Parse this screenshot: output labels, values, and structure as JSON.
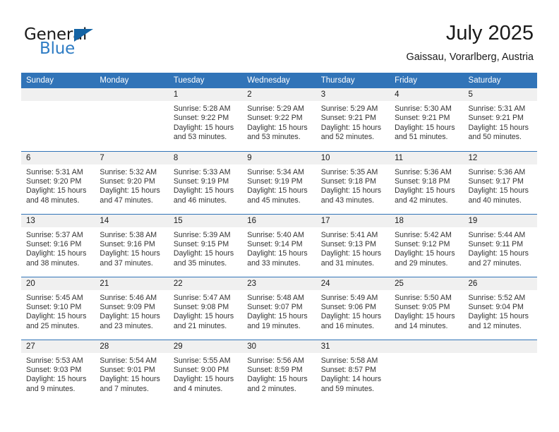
{
  "brand": {
    "name_primary": "General",
    "name_secondary": "Blue",
    "triangle_icon": "triangle-icon",
    "accent_color": "#1464a5",
    "secondary_color": "#2e7cc4"
  },
  "header": {
    "title": "July 2025",
    "location": "Gaissau, Vorarlberg, Austria"
  },
  "theme": {
    "header_row_color": "#3174b8",
    "daynum_band_color": "#f0f0f0",
    "text_color": "#333333"
  },
  "weekday_headers": [
    "Sunday",
    "Monday",
    "Tuesday",
    "Wednesday",
    "Thursday",
    "Friday",
    "Saturday"
  ],
  "weeks": [
    [
      {
        "empty": true
      },
      {
        "empty": true
      },
      {
        "day": "1",
        "sunrise": "Sunrise: 5:28 AM",
        "sunset": "Sunset: 9:22 PM",
        "daylight": "Daylight: 15 hours and 53 minutes."
      },
      {
        "day": "2",
        "sunrise": "Sunrise: 5:29 AM",
        "sunset": "Sunset: 9:22 PM",
        "daylight": "Daylight: 15 hours and 53 minutes."
      },
      {
        "day": "3",
        "sunrise": "Sunrise: 5:29 AM",
        "sunset": "Sunset: 9:21 PM",
        "daylight": "Daylight: 15 hours and 52 minutes."
      },
      {
        "day": "4",
        "sunrise": "Sunrise: 5:30 AM",
        "sunset": "Sunset: 9:21 PM",
        "daylight": "Daylight: 15 hours and 51 minutes."
      },
      {
        "day": "5",
        "sunrise": "Sunrise: 5:31 AM",
        "sunset": "Sunset: 9:21 PM",
        "daylight": "Daylight: 15 hours and 50 minutes."
      }
    ],
    [
      {
        "day": "6",
        "sunrise": "Sunrise: 5:31 AM",
        "sunset": "Sunset: 9:20 PM",
        "daylight": "Daylight: 15 hours and 48 minutes."
      },
      {
        "day": "7",
        "sunrise": "Sunrise: 5:32 AM",
        "sunset": "Sunset: 9:20 PM",
        "daylight": "Daylight: 15 hours and 47 minutes."
      },
      {
        "day": "8",
        "sunrise": "Sunrise: 5:33 AM",
        "sunset": "Sunset: 9:19 PM",
        "daylight": "Daylight: 15 hours and 46 minutes."
      },
      {
        "day": "9",
        "sunrise": "Sunrise: 5:34 AM",
        "sunset": "Sunset: 9:19 PM",
        "daylight": "Daylight: 15 hours and 45 minutes."
      },
      {
        "day": "10",
        "sunrise": "Sunrise: 5:35 AM",
        "sunset": "Sunset: 9:18 PM",
        "daylight": "Daylight: 15 hours and 43 minutes."
      },
      {
        "day": "11",
        "sunrise": "Sunrise: 5:36 AM",
        "sunset": "Sunset: 9:18 PM",
        "daylight": "Daylight: 15 hours and 42 minutes."
      },
      {
        "day": "12",
        "sunrise": "Sunrise: 5:36 AM",
        "sunset": "Sunset: 9:17 PM",
        "daylight": "Daylight: 15 hours and 40 minutes."
      }
    ],
    [
      {
        "day": "13",
        "sunrise": "Sunrise: 5:37 AM",
        "sunset": "Sunset: 9:16 PM",
        "daylight": "Daylight: 15 hours and 38 minutes."
      },
      {
        "day": "14",
        "sunrise": "Sunrise: 5:38 AM",
        "sunset": "Sunset: 9:16 PM",
        "daylight": "Daylight: 15 hours and 37 minutes."
      },
      {
        "day": "15",
        "sunrise": "Sunrise: 5:39 AM",
        "sunset": "Sunset: 9:15 PM",
        "daylight": "Daylight: 15 hours and 35 minutes."
      },
      {
        "day": "16",
        "sunrise": "Sunrise: 5:40 AM",
        "sunset": "Sunset: 9:14 PM",
        "daylight": "Daylight: 15 hours and 33 minutes."
      },
      {
        "day": "17",
        "sunrise": "Sunrise: 5:41 AM",
        "sunset": "Sunset: 9:13 PM",
        "daylight": "Daylight: 15 hours and 31 minutes."
      },
      {
        "day": "18",
        "sunrise": "Sunrise: 5:42 AM",
        "sunset": "Sunset: 9:12 PM",
        "daylight": "Daylight: 15 hours and 29 minutes."
      },
      {
        "day": "19",
        "sunrise": "Sunrise: 5:44 AM",
        "sunset": "Sunset: 9:11 PM",
        "daylight": "Daylight: 15 hours and 27 minutes."
      }
    ],
    [
      {
        "day": "20",
        "sunrise": "Sunrise: 5:45 AM",
        "sunset": "Sunset: 9:10 PM",
        "daylight": "Daylight: 15 hours and 25 minutes."
      },
      {
        "day": "21",
        "sunrise": "Sunrise: 5:46 AM",
        "sunset": "Sunset: 9:09 PM",
        "daylight": "Daylight: 15 hours and 23 minutes."
      },
      {
        "day": "22",
        "sunrise": "Sunrise: 5:47 AM",
        "sunset": "Sunset: 9:08 PM",
        "daylight": "Daylight: 15 hours and 21 minutes."
      },
      {
        "day": "23",
        "sunrise": "Sunrise: 5:48 AM",
        "sunset": "Sunset: 9:07 PM",
        "daylight": "Daylight: 15 hours and 19 minutes."
      },
      {
        "day": "24",
        "sunrise": "Sunrise: 5:49 AM",
        "sunset": "Sunset: 9:06 PM",
        "daylight": "Daylight: 15 hours and 16 minutes."
      },
      {
        "day": "25",
        "sunrise": "Sunrise: 5:50 AM",
        "sunset": "Sunset: 9:05 PM",
        "daylight": "Daylight: 15 hours and 14 minutes."
      },
      {
        "day": "26",
        "sunrise": "Sunrise: 5:52 AM",
        "sunset": "Sunset: 9:04 PM",
        "daylight": "Daylight: 15 hours and 12 minutes."
      }
    ],
    [
      {
        "day": "27",
        "sunrise": "Sunrise: 5:53 AM",
        "sunset": "Sunset: 9:03 PM",
        "daylight": "Daylight: 15 hours and 9 minutes."
      },
      {
        "day": "28",
        "sunrise": "Sunrise: 5:54 AM",
        "sunset": "Sunset: 9:01 PM",
        "daylight": "Daylight: 15 hours and 7 minutes."
      },
      {
        "day": "29",
        "sunrise": "Sunrise: 5:55 AM",
        "sunset": "Sunset: 9:00 PM",
        "daylight": "Daylight: 15 hours and 4 minutes."
      },
      {
        "day": "30",
        "sunrise": "Sunrise: 5:56 AM",
        "sunset": "Sunset: 8:59 PM",
        "daylight": "Daylight: 15 hours and 2 minutes."
      },
      {
        "day": "31",
        "sunrise": "Sunrise: 5:58 AM",
        "sunset": "Sunset: 8:57 PM",
        "daylight": "Daylight: 14 hours and 59 minutes."
      },
      {
        "empty": true
      },
      {
        "empty": true
      }
    ]
  ]
}
